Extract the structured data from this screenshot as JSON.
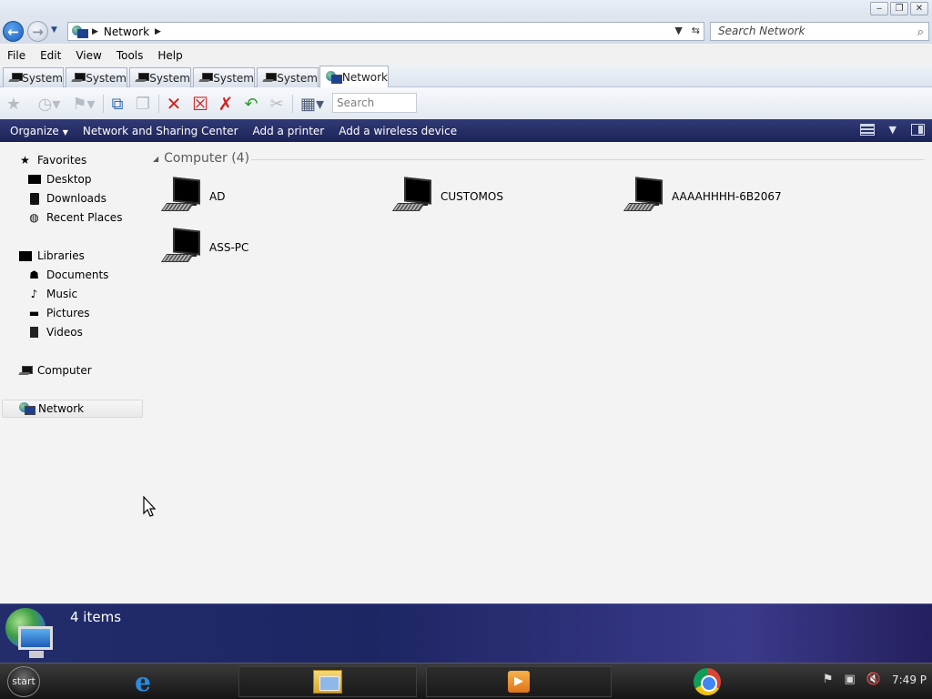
{
  "window": {
    "controls": {
      "minimize": "‒",
      "maximize": "❐",
      "close": "✕"
    }
  },
  "address": {
    "location": "Network",
    "search_placeholder": "Search Network"
  },
  "menu": [
    "File",
    "Edit",
    "View",
    "Tools",
    "Help"
  ],
  "tabs": [
    {
      "label": "System",
      "icon": "computer-icon"
    },
    {
      "label": "System",
      "icon": "computer-icon"
    },
    {
      "label": "System",
      "icon": "computer-icon"
    },
    {
      "label": "System",
      "icon": "computer-icon"
    },
    {
      "label": "System",
      "icon": "computer-icon"
    },
    {
      "label": "Network",
      "icon": "network-icon",
      "active": true
    }
  ],
  "toolbar": {
    "search_placeholder": "Search"
  },
  "commandbar": {
    "organize": "Organize",
    "network_sharing": "Network and Sharing Center",
    "add_printer": "Add a printer",
    "add_wireless": "Add a wireless device"
  },
  "navpane": {
    "favorites": "Favorites",
    "desktop": "Desktop",
    "downloads": "Downloads",
    "recent_places": "Recent Places",
    "libraries": "Libraries",
    "documents": "Documents",
    "music": "Music",
    "pictures": "Pictures",
    "videos": "Videos",
    "computer": "Computer",
    "network": "Network"
  },
  "content": {
    "group_header": "Computer (4)",
    "computers": [
      "AD",
      "CUSTOMOS",
      "AAAAHHHH-6B2067",
      "ASS-PC"
    ]
  },
  "details": {
    "item_count": "4 items"
  },
  "taskbar": {
    "start_label": "start",
    "clock": "7:49 P"
  },
  "colors": {
    "command_bar": "#1f2660",
    "details_pane": "#1d2563",
    "accent_blue": "#1b5fc1"
  }
}
